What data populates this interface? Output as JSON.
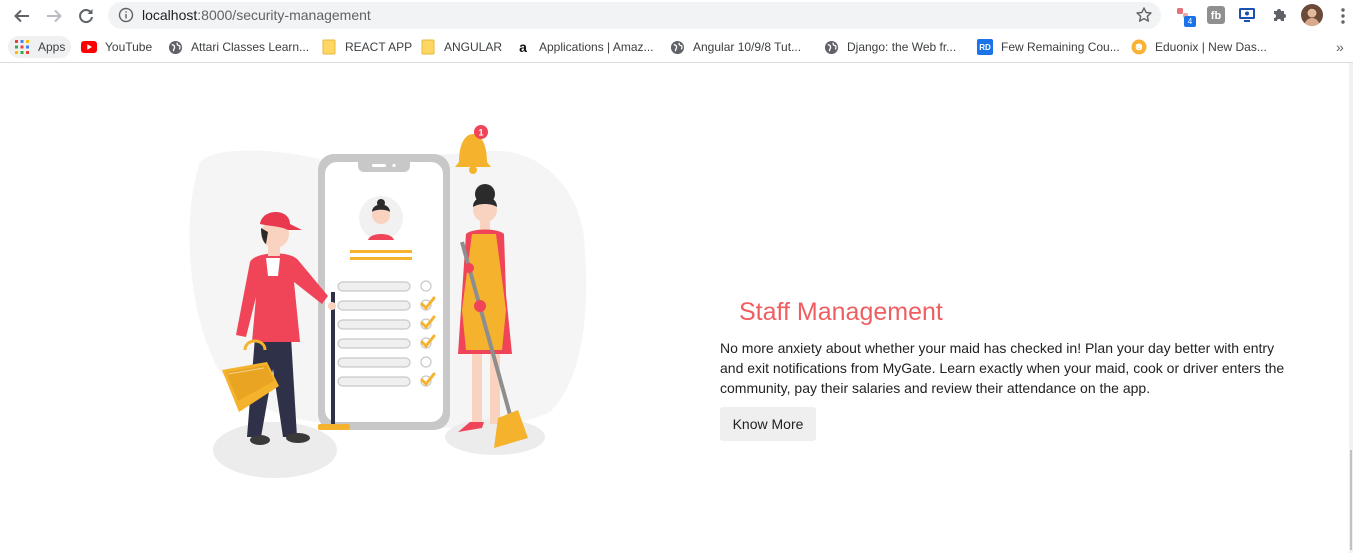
{
  "browser": {
    "url_host": "localhost",
    "url_path": ":8000/security-management",
    "extension_badge": "4",
    "extension_fb_label": "fb"
  },
  "bookmarks": [
    {
      "label": "Apps",
      "icon": "apps-grid-icon"
    },
    {
      "label": "YouTube",
      "icon": "youtube-icon"
    },
    {
      "label": "Attari Classes Learn...",
      "icon": "globe-icon"
    },
    {
      "label": "REACT APP",
      "icon": "folder-icon"
    },
    {
      "label": "ANGULAR",
      "icon": "folder-icon"
    },
    {
      "label": "Applications | Amaz...",
      "icon": "amazon-icon"
    },
    {
      "label": "Angular 10/9/8 Tut...",
      "icon": "globe-icon"
    },
    {
      "label": "Django: the Web fr...",
      "icon": "globe-icon"
    },
    {
      "label": "Few Remaining Cou...",
      "icon": "rd-icon",
      "icon_text": "RD"
    },
    {
      "label": "Eduonix | New Das...",
      "icon": "eduonix-icon"
    }
  ],
  "content": {
    "title": "Staff Management",
    "description": "No more anxiety about whether your maid has checked in! Plan your day better with entry and exit notifications from MyGate. Learn exactly when your maid, cook or driver enters the community, pay their salaries and review their attendance on the app.",
    "button_label": "Know More",
    "notification_count": "1"
  },
  "colors": {
    "accent": "#ef5e61",
    "illustration_red": "#f04458",
    "illustration_yellow": "#f5b32d"
  }
}
